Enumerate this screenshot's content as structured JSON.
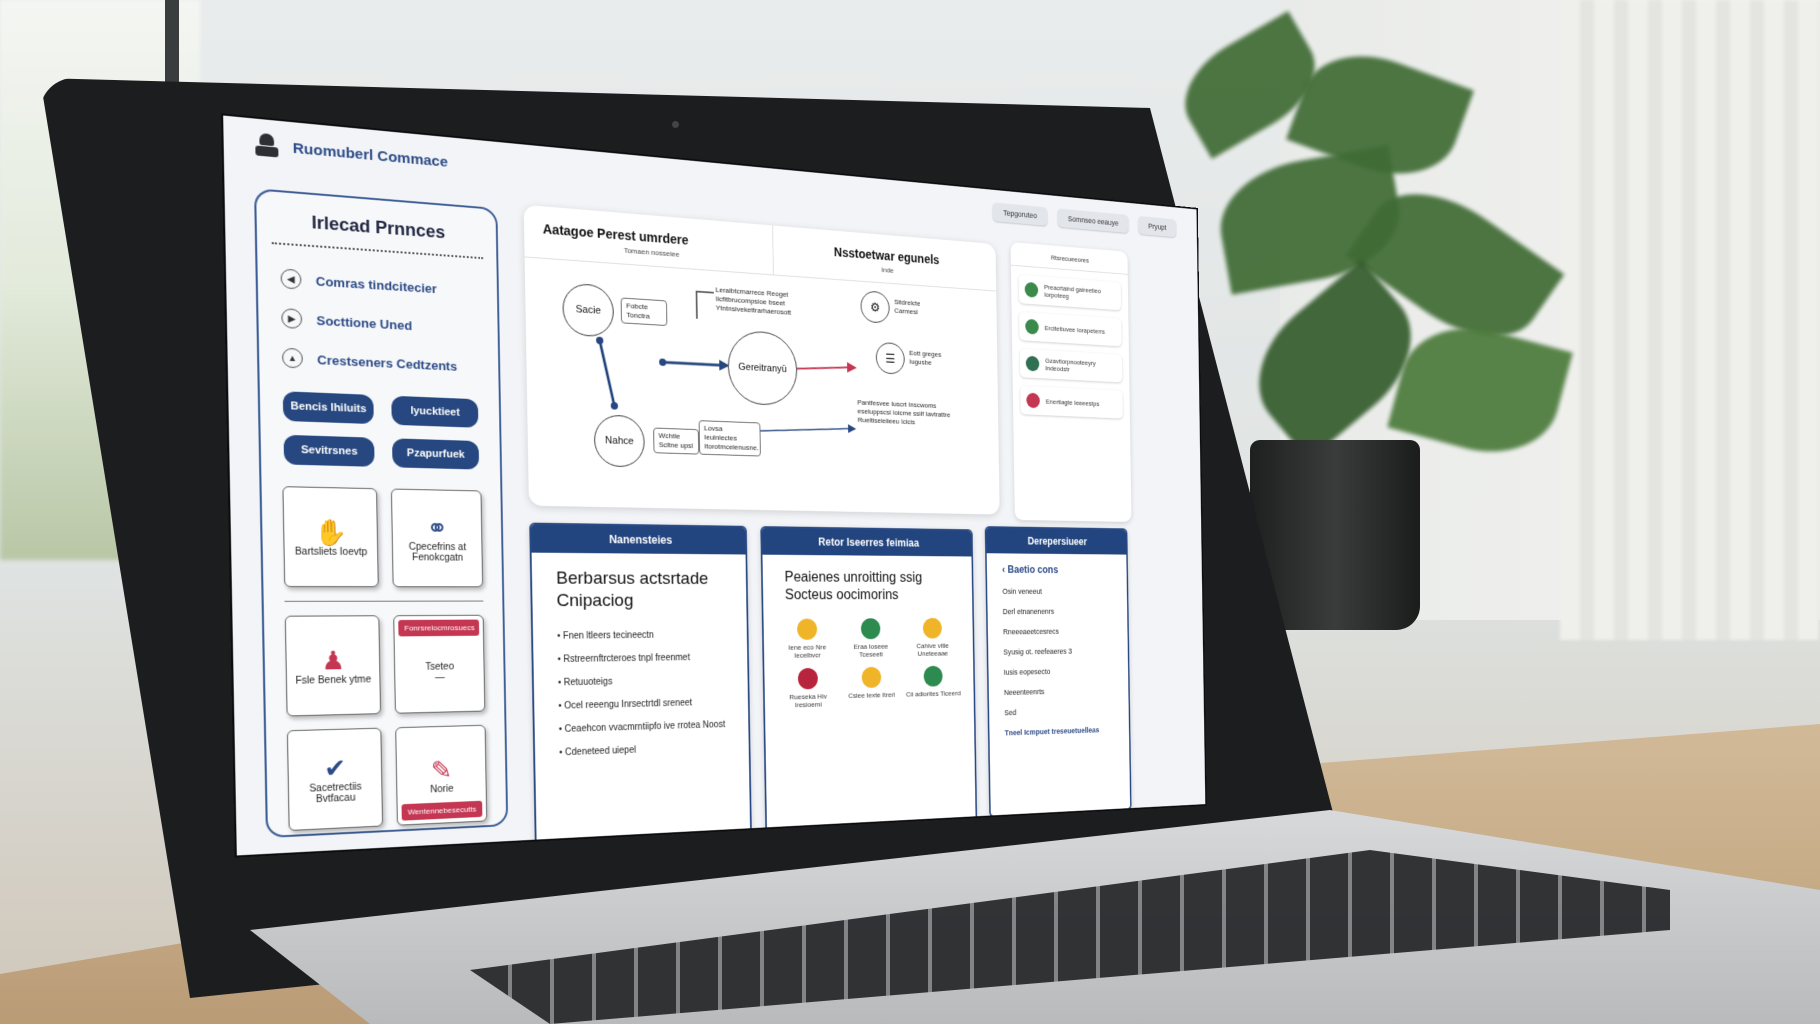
{
  "app": {
    "title": "Ruomuberl Commace"
  },
  "header": {
    "chips": [
      "Tepgoruteo",
      "Somnseo eeauye",
      "Pryupt"
    ]
  },
  "sidebar": {
    "title": "Irlecad Prnnces",
    "nav": [
      {
        "label": "Comras tindcitecier",
        "icon": "arrow-left-icon"
      },
      {
        "label": "Socttione Uned",
        "icon": "play-icon"
      },
      {
        "label": "Crestseners Cedtzents",
        "icon": "chevron-up-icon"
      }
    ],
    "buttons": [
      "Bencis Ihiluits",
      "Iyucktieet",
      "Sevitrsnes",
      "Pzapurfuek"
    ],
    "cards": [
      {
        "label": "Bartsliets Ioevtp",
        "icon": "hand-icon"
      },
      {
        "label": "Cpecefrins at Fenokcgatn",
        "icon": "network-icon"
      },
      {
        "label": "Fsle Benek ytme",
        "icon": "person-icon"
      },
      {
        "label": "Tseteo",
        "tag": "Fonrsrelocmrosuecs"
      },
      {
        "label": "Sacetrectiis Bvtfacau",
        "icon": "checkmark-icon"
      },
      {
        "label": "Norie",
        "tag": "Wentennebesecutts"
      }
    ]
  },
  "diagram": {
    "tab_main": "Aatagoe Perest umrdere",
    "tab_caption": "Tomaen nosseiee",
    "tab_sub": "Nsstoetwar egunels",
    "sub_caption": "Inde",
    "nodes": {
      "state": "Sacie",
      "center": "Gereitranyü",
      "notice": "Nahce"
    },
    "notes": {
      "state_note": "Fobcte Tonctra",
      "top_note": "Leraibtcmarrece Reoget Iicfitbrucompsioe bseet Ytntnsivekettrarhaerosott",
      "notice_note": "Wchtie Scltne upsl",
      "bottom_note": "Lovsa Ieulnlectes Itorotmceienusne.",
      "right_note": "Pantfesvee Iuscrt Inscwoms eseluppscsi Ioicme ssilf Iavtrattre Rueltiseieiieeu Icicis",
      "icon1_note": "Sitdrelcte Carmesi",
      "icon2_note": "Eott greges Iugusbe"
    }
  },
  "right_mini": {
    "head": "Rtsrecueeores",
    "rows": [
      {
        "text": "Preacrtaind gaireetieo Iorpoteeg",
        "color": "#3b8a4c"
      },
      {
        "text": "Ercitetiuvee Iorapeterrs",
        "color": "#3b8a4c"
      },
      {
        "text": "Gzavtiorpnooteeyry Indeodstr",
        "color": "#2f6f52"
      },
      {
        "text": "Enertiagte Ieeeestps",
        "color": "#c43652"
      }
    ]
  },
  "card_left": {
    "head": "Nanensteies",
    "title": "Berbarsus actsrtade Cnipaciog",
    "bullets": [
      "Fnen ltleers tecineectn",
      "Rstreernftrcteroes tnpl freenmet",
      "Retuuoteigs",
      "Ocel reeengu Inrsectrtdl sreneet",
      "Ceaehcon vvacmrntiipfo ive rrotea Noost",
      "Cdeneteed uiepel"
    ]
  },
  "card_mid": {
    "head": "Retor Iseerres feimiaa",
    "title": "Peaienes unroitting ssig Socteus oocimorins",
    "people": [
      {
        "name": "Iene eco Nre Iecelbvcr",
        "color": "#f0b429"
      },
      {
        "name": "Eraa Ioseee Tceseeti",
        "color": "#2e8b4f"
      },
      {
        "name": "Cahive vitie Uneteeaae",
        "color": "#f0b429"
      },
      {
        "name": "Rueseka Hiv Iresioemi",
        "color": "#b8243e"
      },
      {
        "name": "Csiee Iexte Itrerl",
        "color": "#f0b429"
      },
      {
        "name": "Cii adiorites Ticeerd",
        "color": "#2e8b4f"
      }
    ]
  },
  "card_right": {
    "head": "Derepersiueer",
    "link": "Baetio cons",
    "items": [
      "Osin veneeut",
      "Derl etnanenenrs",
      "Rneeeaeetcesrecs",
      "Syusig ot. reefeaeres 3",
      "Iusis eopesecto",
      "Neeenteenrts",
      "Sed"
    ],
    "footer": "Tneel Icmpuet treseuetuelleas"
  }
}
